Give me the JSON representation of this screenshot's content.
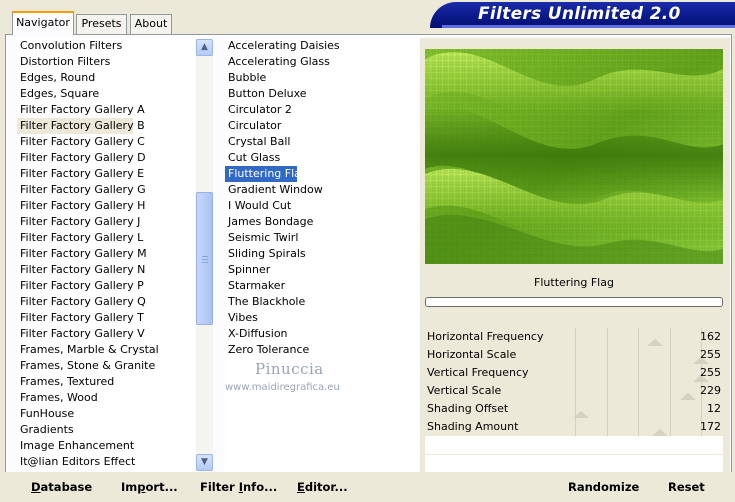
{
  "app": {
    "title": "Filters Unlimited 2.0"
  },
  "tabs": [
    {
      "label": "Navigator",
      "active": true
    },
    {
      "label": "Presets",
      "active": false
    },
    {
      "label": "About",
      "active": false
    }
  ],
  "categories": {
    "selected": "Filter Factory Gallery B",
    "items": [
      "Convolution Filters",
      "Distortion Filters",
      "Edges, Round",
      "Edges, Square",
      "Filter Factory Gallery A",
      "Filter Factory Gallery B",
      "Filter Factory Gallery C",
      "Filter Factory Gallery D",
      "Filter Factory Gallery E",
      "Filter Factory Gallery G",
      "Filter Factory Gallery H",
      "Filter Factory Gallery J",
      "Filter Factory Gallery L",
      "Filter Factory Gallery M",
      "Filter Factory Gallery N",
      "Filter Factory Gallery P",
      "Filter Factory Gallery Q",
      "Filter Factory Gallery T",
      "Filter Factory Gallery V",
      "Frames, Marble & Crystal",
      "Frames, Stone & Granite",
      "Frames, Textured",
      "Frames, Wood",
      "FunHouse",
      "Gradients",
      "Image Enhancement",
      "It@lian Editors Effect"
    ]
  },
  "filters": {
    "selected": "Fluttering Flag",
    "items": [
      "Accelerating Daisies",
      "Accelerating Glass",
      "Bubble",
      "Button Deluxe",
      "Circulator 2",
      "Circulator",
      "Crystal Ball",
      "Cut Glass",
      "Fluttering Flag",
      "Gradient Window",
      "I Would Cut",
      "James Bondage",
      "Seismic Twirl",
      "Sliding Spirals",
      "Spinner",
      "Starmaker",
      "The Blackhole",
      "Vibes",
      "X-Diffusion",
      "Zero Tolerance"
    ]
  },
  "preview": {
    "filter_name": "Fluttering Flag",
    "progress": 0,
    "colors": {
      "light": "#b6e24e",
      "dark": "#3e7f0a",
      "mid": "#6eab22"
    }
  },
  "parameters": [
    {
      "label": "Horizontal Frequency",
      "value": "162",
      "max": 255
    },
    {
      "label": "Horizontal Scale",
      "value": "255",
      "max": 255
    },
    {
      "label": "Vertical Frequency",
      "value": "255",
      "max": 255
    },
    {
      "label": "Vertical Scale",
      "value": "229",
      "max": 255
    },
    {
      "label": "Shading Offset",
      "value": "12",
      "max": 255
    },
    {
      "label": "Shading Amount",
      "value": "172",
      "max": 255
    }
  ],
  "buttons": {
    "database": {
      "mnemonic": "D",
      "rest": "atabase"
    },
    "import": {
      "pre": "Im",
      "mnemonic": "p",
      "rest": "ort..."
    },
    "filter_info": {
      "pre": "Filter ",
      "mnemonic": "I",
      "rest": "nfo..."
    },
    "editor": {
      "mnemonic": "E",
      "rest": "ditor..."
    },
    "randomize": "Randomize",
    "reset": "Reset"
  },
  "watermark": {
    "line1": "Pinuccia",
    "line2": "www.maidiregrafica.eu"
  },
  "colors": {
    "window_bg": "#ece9d8",
    "banner": "#0a1a8a",
    "selection_blue": "#316ac5"
  }
}
